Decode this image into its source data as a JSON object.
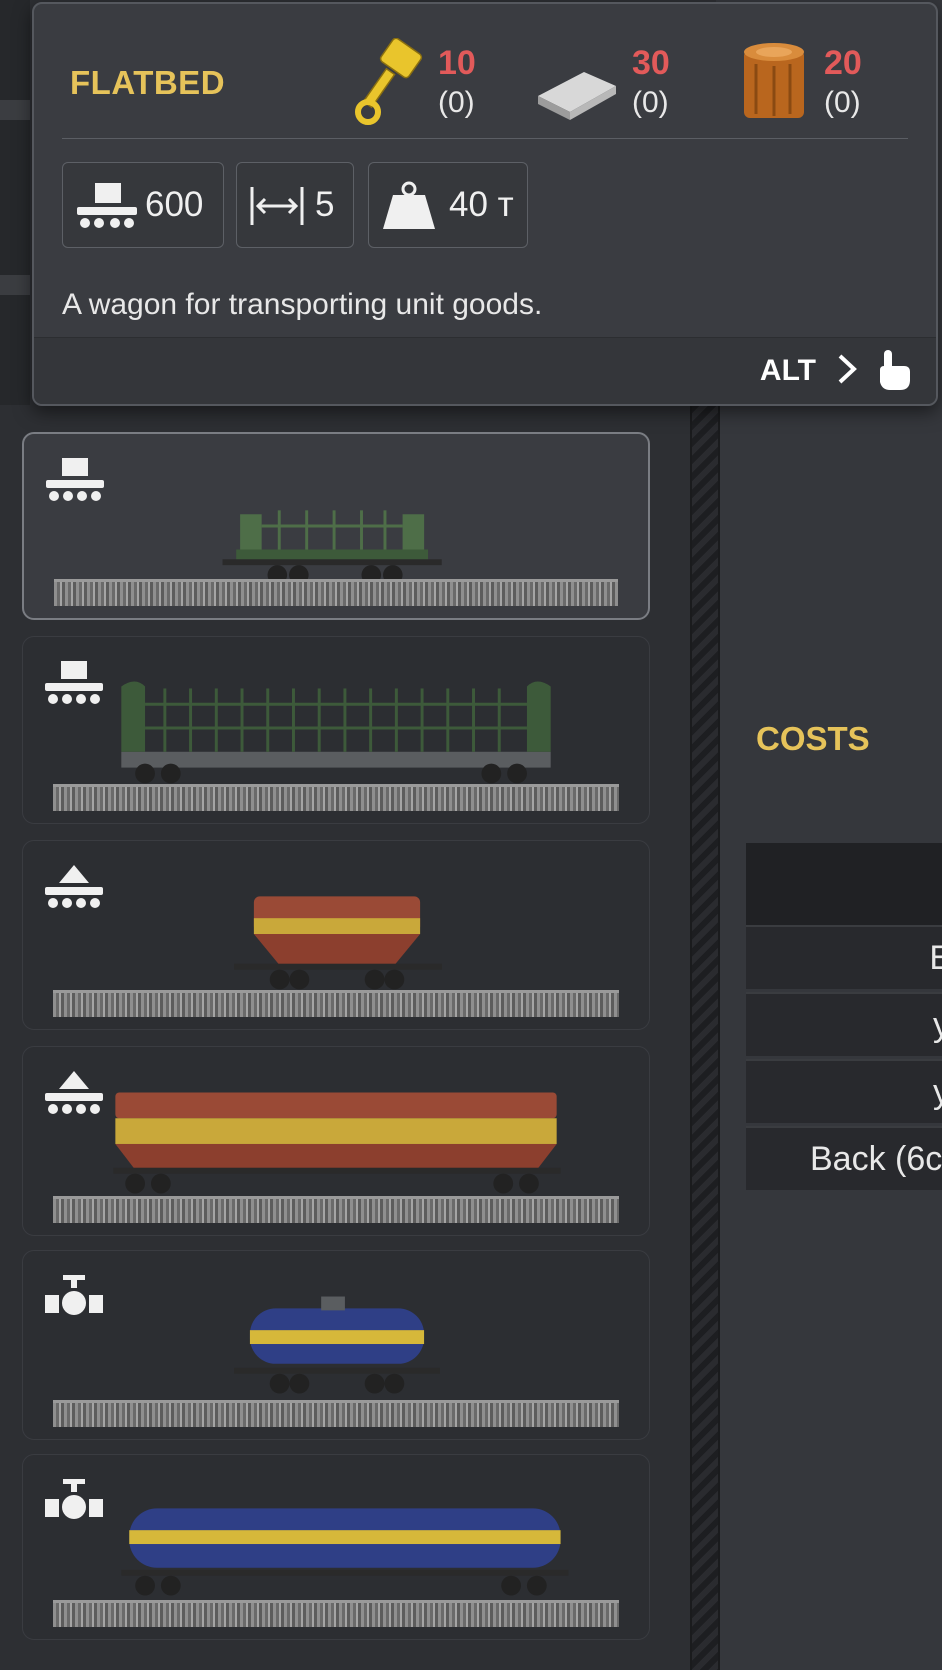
{
  "tooltip": {
    "title": "FLATBED",
    "resources": [
      {
        "icon": "piston-icon",
        "needed": "10",
        "have": "(0)"
      },
      {
        "icon": "steel-plate-icon",
        "needed": "30",
        "have": "(0)"
      },
      {
        "icon": "wood-log-icon",
        "needed": "20",
        "have": "(0)"
      }
    ],
    "stats": {
      "capacity": "600",
      "length": "5",
      "weight": "40 т"
    },
    "description": "A wagon for transporting unit goods.",
    "alt_label": "ALT"
  },
  "wagons": [
    {
      "cargo_icon": "unit-goods-icon",
      "type": "flatbed-short"
    },
    {
      "cargo_icon": "unit-goods-icon",
      "type": "flatbed-long"
    },
    {
      "cargo_icon": "bulk-cargo-icon",
      "type": "hopper-short"
    },
    {
      "cargo_icon": "bulk-cargo-icon",
      "type": "hopper-long"
    },
    {
      "cargo_icon": "liquid-valve-icon",
      "type": "tanker-short"
    },
    {
      "cargo_icon": "liquid-valve-icon",
      "type": "tanker-long"
    }
  ],
  "costs": {
    "title": "COSTS",
    "rows": [
      "E",
      "y",
      "y",
      "Back (6c"
    ]
  },
  "colors": {
    "accent": "#e6c35a",
    "missing": "#e25a5a"
  }
}
